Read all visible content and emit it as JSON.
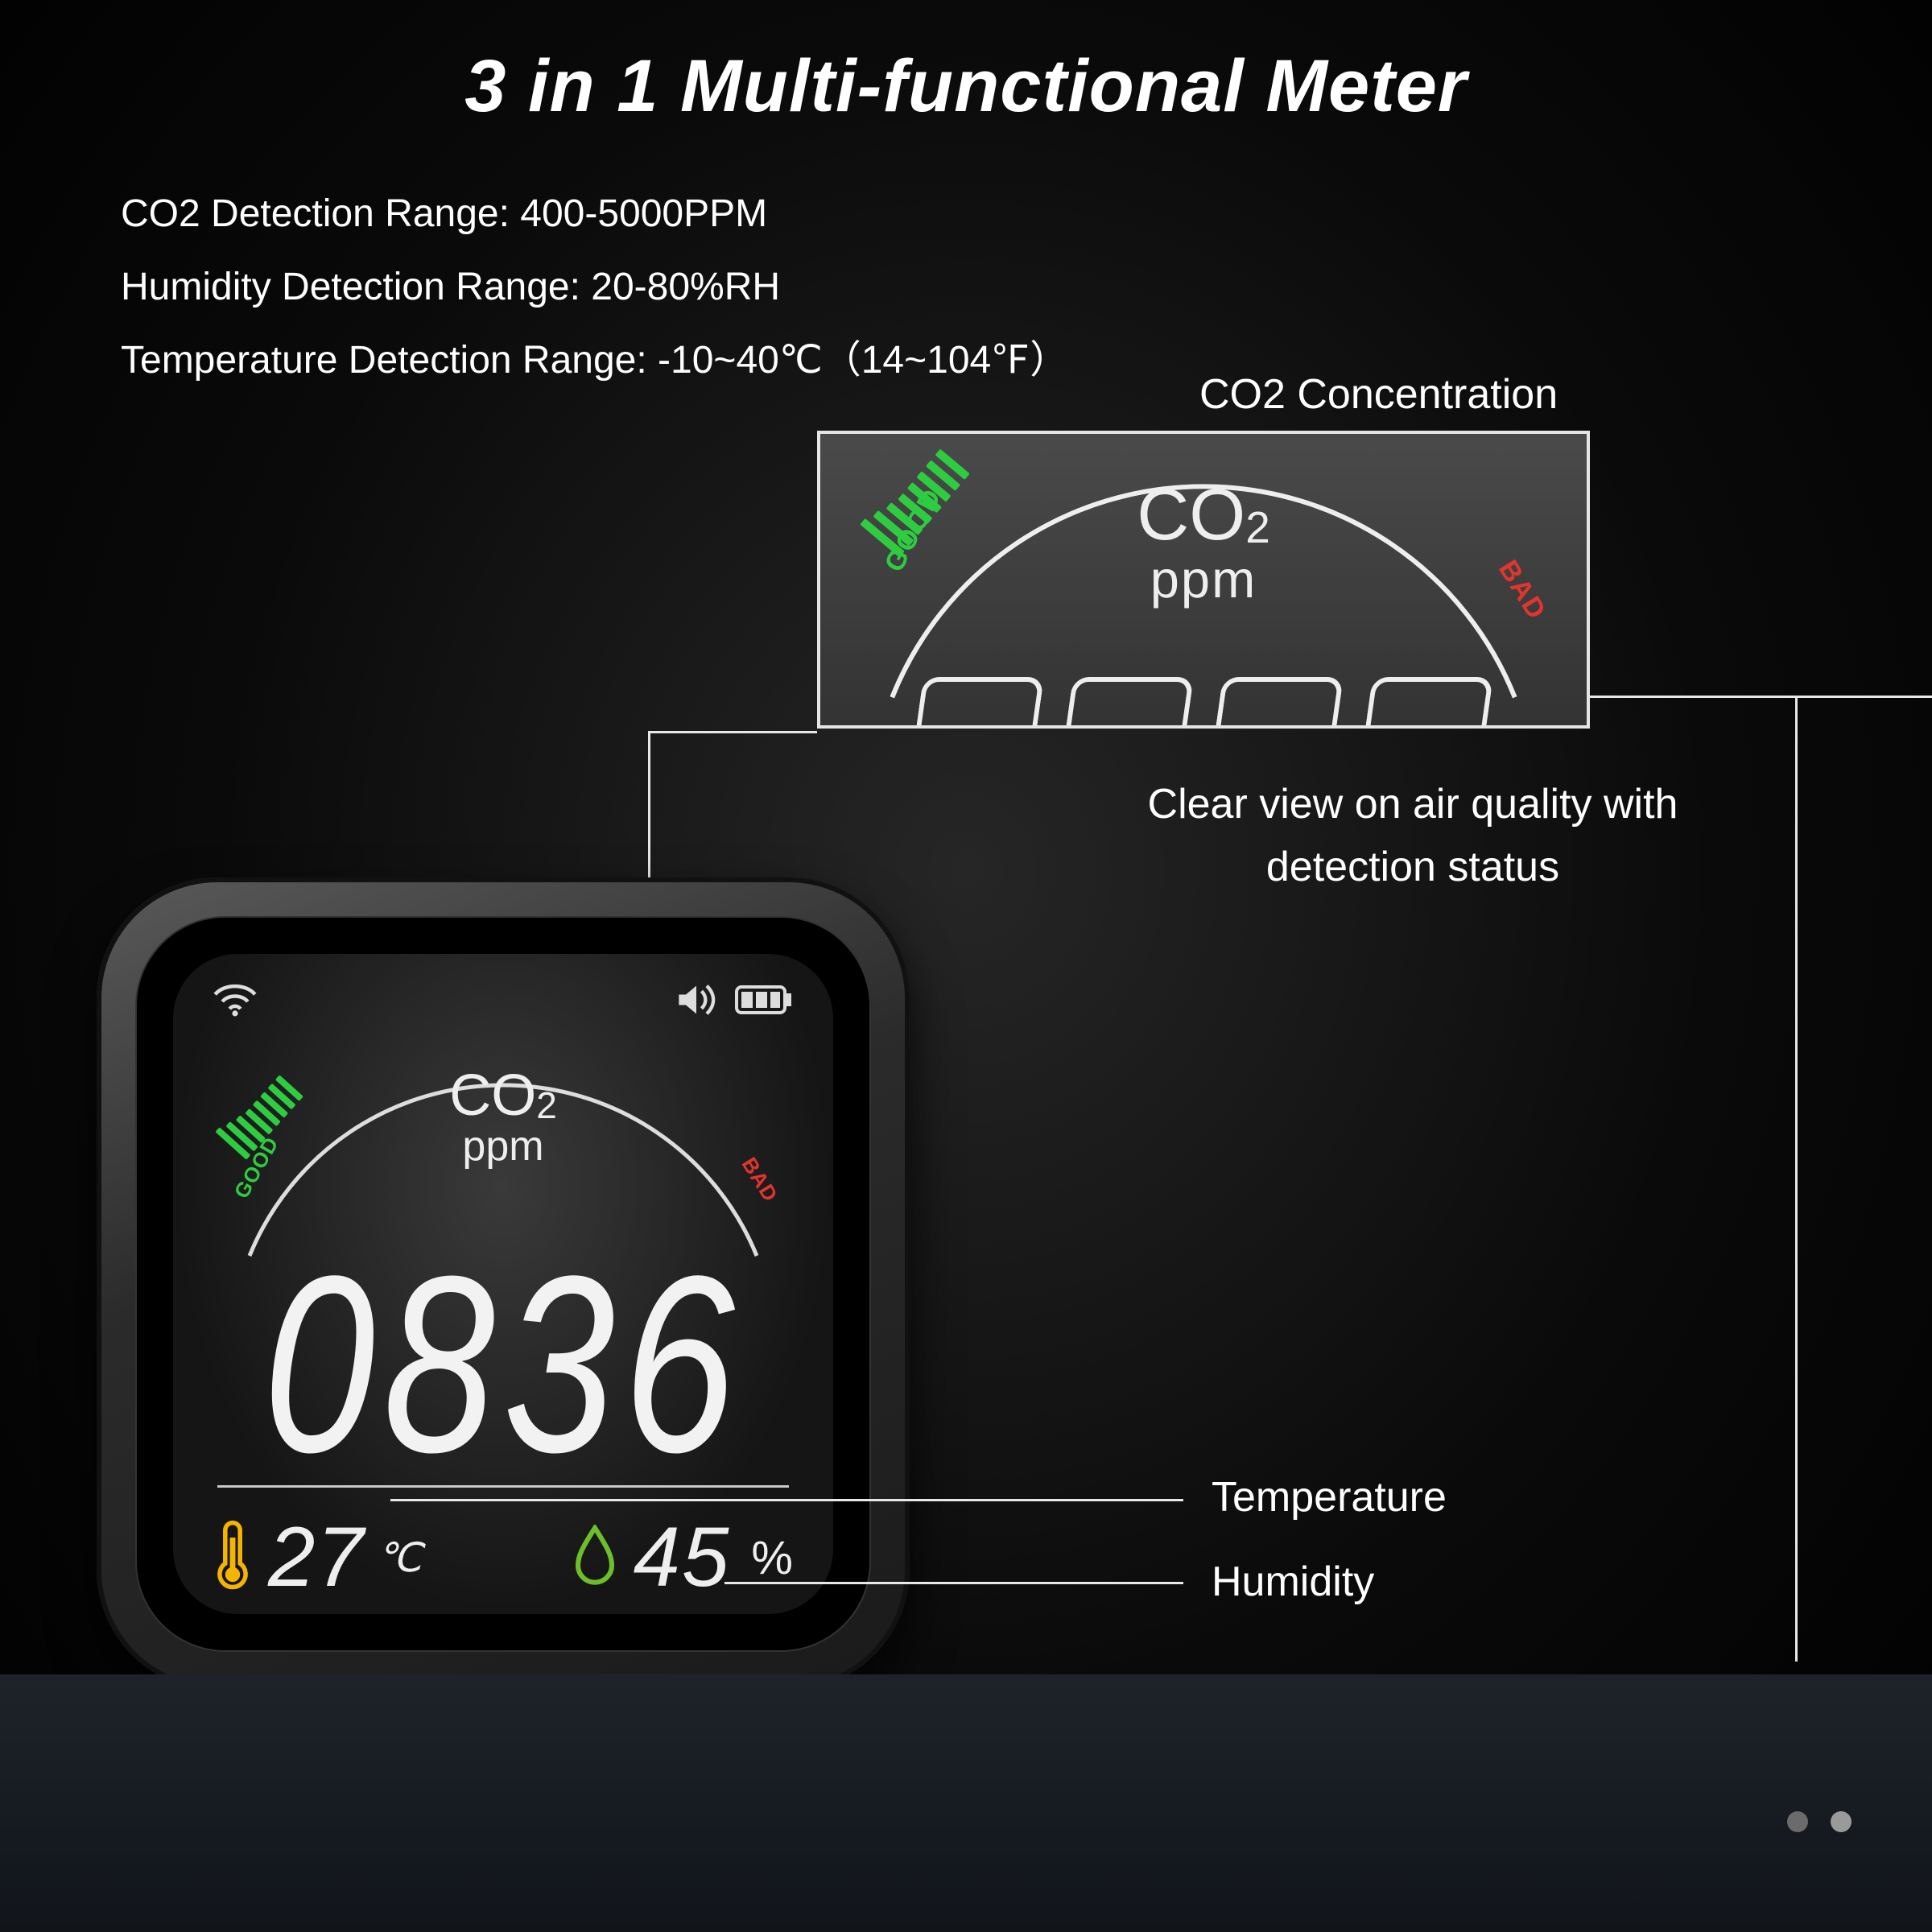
{
  "header": {
    "title": "3 in 1 Multi-functional Meter"
  },
  "specs": {
    "co2": "CO2 Detection Range: 400-5000PPM",
    "hum": "Humidity Detection Range: 20-80%RH",
    "temp": "Temperature Detection Range: -10~40℃（14~104℉）"
  },
  "callouts": {
    "co2_title": "CO2 Concentration",
    "co2_caption": "Clear view on air quality with detection status",
    "temp_label": "Temperature",
    "hum_label": "Humidity"
  },
  "gauge": {
    "label_line1": "CO",
    "label_sub": "2",
    "label_unit": "ppm",
    "good": "GOOD",
    "bad": "BAD"
  },
  "readings": {
    "co2_value": "0836",
    "temperature_value": "27",
    "temperature_unit": "℃",
    "humidity_value": "45",
    "humidity_unit": "%"
  },
  "icons": {
    "wifi": "wifi-icon",
    "speaker": "speaker-icon",
    "battery": "battery-icon",
    "thermometer": "thermometer-icon",
    "droplet": "droplet-icon"
  },
  "colors": {
    "good": "#2ecc40",
    "bad": "#e3342f",
    "thermo": "#f5b400",
    "drop": "#6cbf2a"
  }
}
